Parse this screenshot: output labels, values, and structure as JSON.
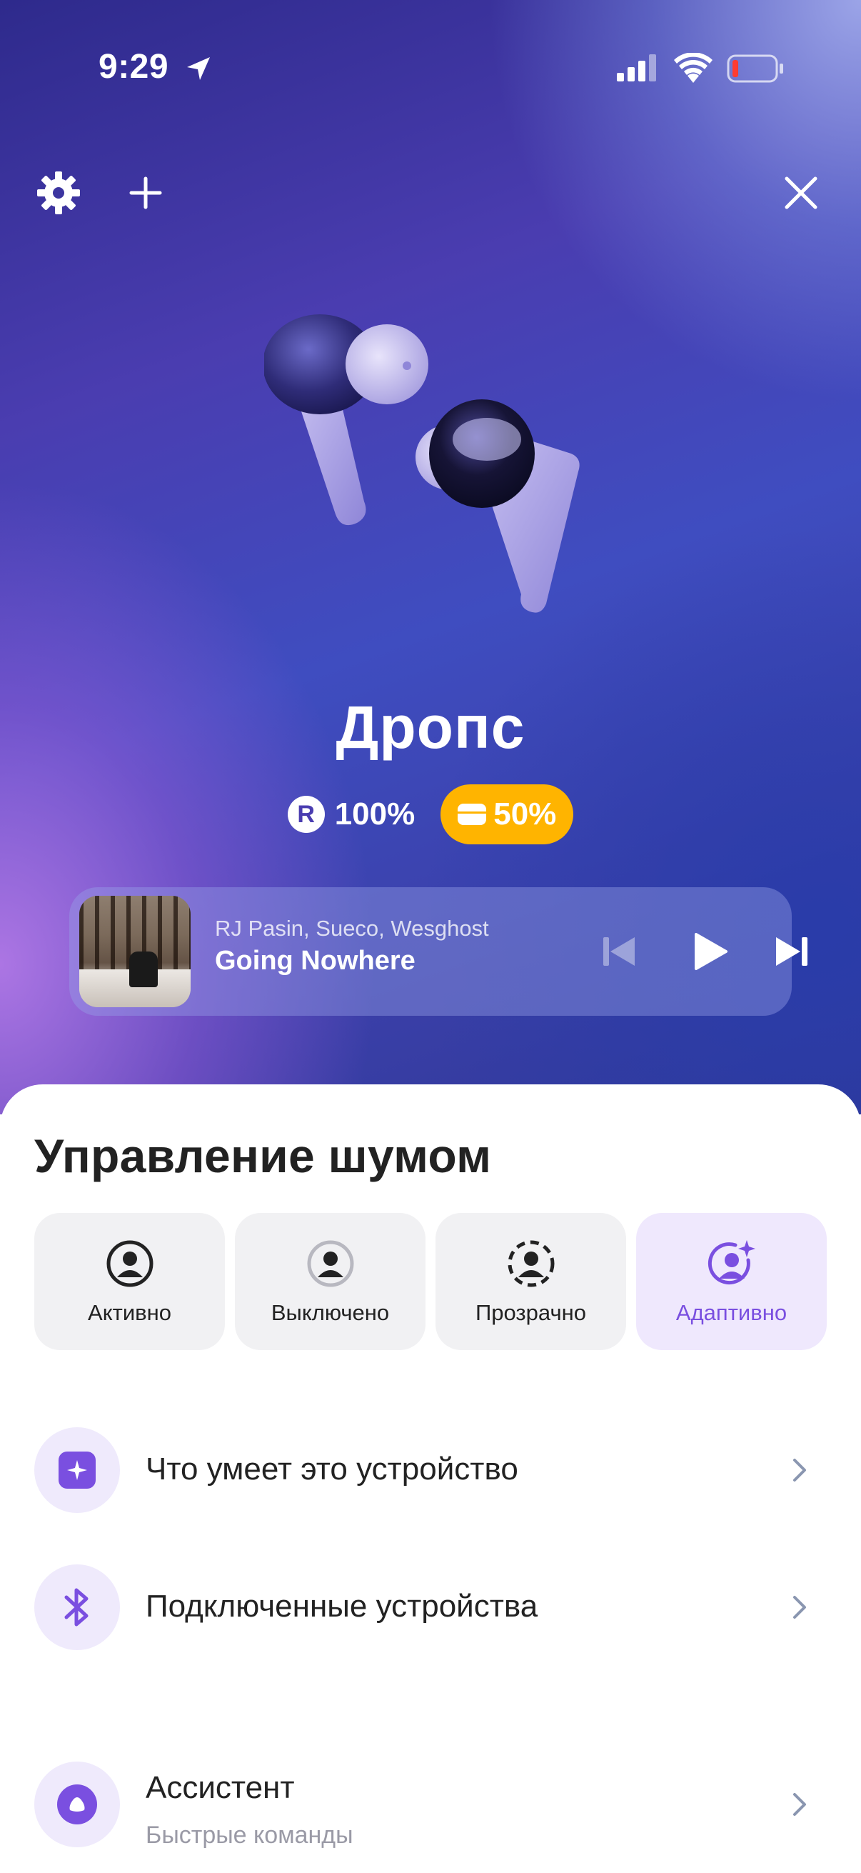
{
  "status_bar": {
    "time": "9:29"
  },
  "device": {
    "name": "Дропс"
  },
  "battery": {
    "earbuds_badge": "R",
    "earbuds": "100%",
    "case": "50%"
  },
  "player": {
    "artist": "RJ Pasin, Sueco, Wesghost",
    "track": "Going Nowhere"
  },
  "noise_control": {
    "title": "Управление шумом",
    "modes": [
      {
        "label": "Активно",
        "selected": false
      },
      {
        "label": "Выключено",
        "selected": false
      },
      {
        "label": "Прозрачно",
        "selected": false
      },
      {
        "label": "Адаптивно",
        "selected": true
      }
    ]
  },
  "menu": [
    {
      "title": "Что умеет это устройство",
      "icon": "sparkle-icon"
    },
    {
      "title": "Подключенные устройства",
      "icon": "bluetooth-icon"
    },
    {
      "title": "Ассистент",
      "subtitle": "Быстрые команды",
      "icon": "alice-icon"
    }
  ],
  "colors": {
    "accent": "#7a4fe0",
    "case_badge": "#ffb400",
    "hero_start": "#2e2a8c",
    "hero_end": "#b278e6"
  }
}
